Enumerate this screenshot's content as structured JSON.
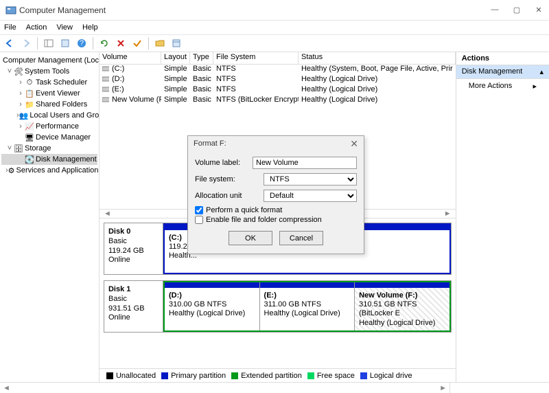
{
  "window": {
    "title": "Computer Management"
  },
  "menu": {
    "items": [
      "File",
      "Action",
      "View",
      "Help"
    ]
  },
  "tree": {
    "root": "Computer Management (Local",
    "system_tools": "System Tools",
    "task_scheduler": "Task Scheduler",
    "event_viewer": "Event Viewer",
    "shared_folders": "Shared Folders",
    "local_users": "Local Users and Groups",
    "performance": "Performance",
    "device_manager": "Device Manager",
    "storage": "Storage",
    "disk_management": "Disk Management",
    "services": "Services and Applications"
  },
  "columns": {
    "volume": "Volume",
    "layout": "Layout",
    "type": "Type",
    "fs": "File System",
    "status": "Status"
  },
  "volumes": [
    {
      "name": "(C:)",
      "layout": "Simple",
      "type": "Basic",
      "fs": "NTFS",
      "status": "Healthy (System, Boot, Page File, Active, Prir"
    },
    {
      "name": "(D:)",
      "layout": "Simple",
      "type": "Basic",
      "fs": "NTFS",
      "status": "Healthy (Logical Drive)"
    },
    {
      "name": "(E:)",
      "layout": "Simple",
      "type": "Basic",
      "fs": "NTFS",
      "status": "Healthy (Logical Drive)"
    },
    {
      "name": "New Volume (F:)",
      "layout": "Simple",
      "type": "Basic",
      "fs": "NTFS (BitLocker Encrypted)",
      "status": "Healthy (Logical Drive)"
    }
  ],
  "disks": [
    {
      "label": "Disk 0",
      "type": "Basic",
      "size": "119.24 GB",
      "state": "Online",
      "parts": [
        {
          "name": "(C:)",
          "size": "119.2",
          "status": "Health..."
        }
      ]
    },
    {
      "label": "Disk 1",
      "type": "Basic",
      "size": "931.51 GB",
      "state": "Online",
      "parts": [
        {
          "name": "(D:)",
          "size": "310.00 GB NTFS",
          "status": "Healthy (Logical Drive)"
        },
        {
          "name": "(E:)",
          "size": "311.00 GB NTFS",
          "status": "Healthy (Logical Drive)"
        },
        {
          "name": "New Volume   (F:)",
          "size": "310.51 GB NTFS (BitLocker E",
          "status": "Healthy (Logical Drive)"
        }
      ]
    }
  ],
  "legend": {
    "unalloc": "Unallocated",
    "primary": "Primary partition",
    "extended": "Extended partition",
    "free": "Free space",
    "logical": "Logical drive"
  },
  "actions": {
    "header": "Actions",
    "selected": "Disk Management",
    "more": "More Actions"
  },
  "dialog": {
    "title": "Format F:",
    "volume_label_lbl": "Volume label:",
    "volume_label_val": "New Volume",
    "fs_lbl": "File system:",
    "fs_val": "NTFS",
    "au_lbl": "Allocation unit",
    "au_val": "Default",
    "quick": "Perform a quick format",
    "compress": "Enable file and folder compression",
    "ok": "OK",
    "cancel": "Cancel"
  }
}
